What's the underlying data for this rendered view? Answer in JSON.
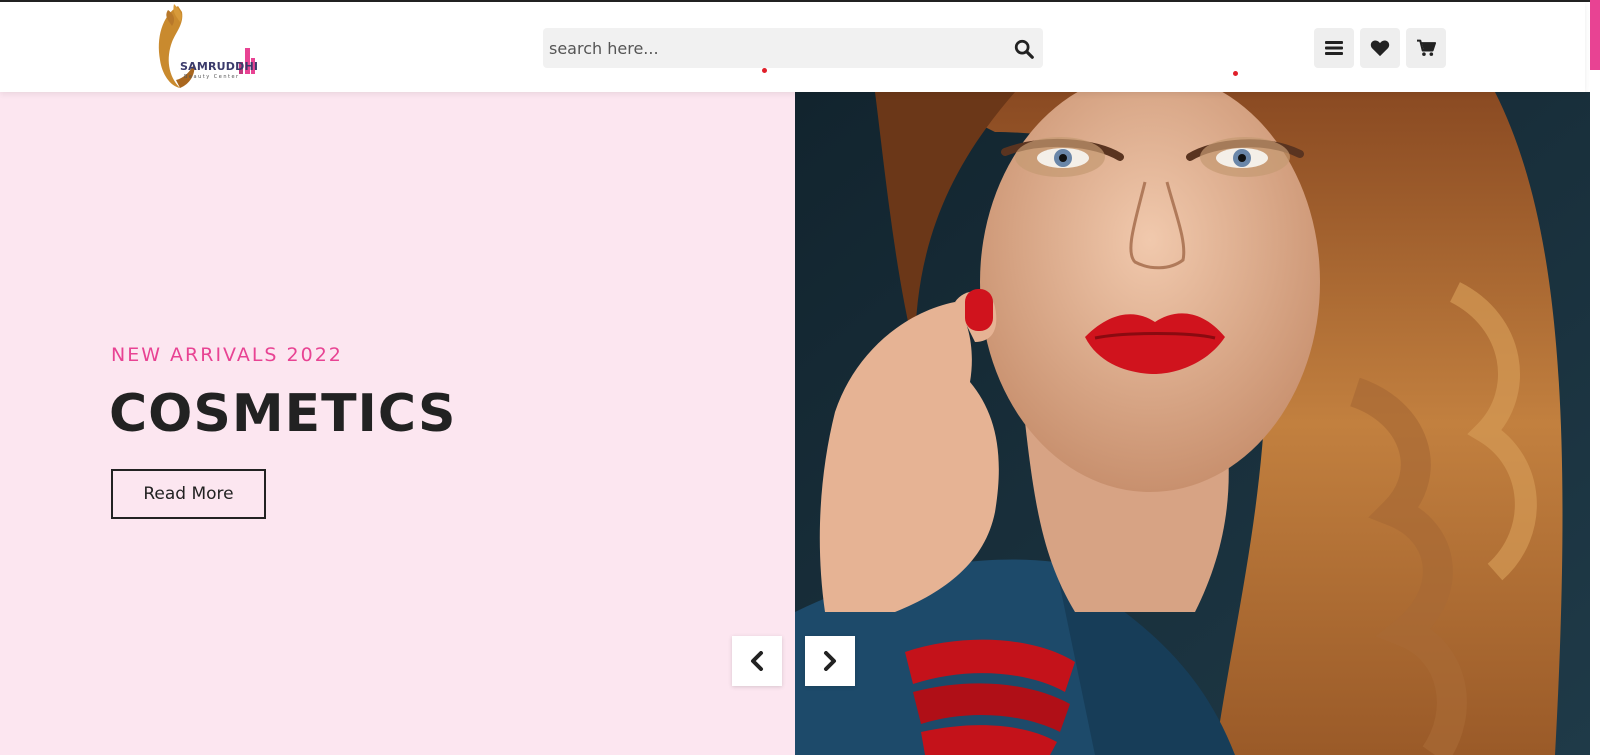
{
  "header": {
    "logo": {
      "name": "SAMRUDDHI",
      "tagline": "Beauty Center"
    },
    "search": {
      "placeholder": "search here..."
    },
    "icons": [
      "search-icon",
      "menu-icon",
      "heart-icon",
      "cart-icon"
    ]
  },
  "hero": {
    "subtitle": "NEW ARRIVALS 2022",
    "title": "COSMETICS",
    "button_label": "Read More",
    "prev_icon": "chevron-left-icon",
    "next_icon": "chevron-right-icon"
  },
  "colors": {
    "accent": "#e84393",
    "hero_bg": "#fce6f0",
    "text_dark": "#222222",
    "dot_red": "#e01f2a"
  }
}
